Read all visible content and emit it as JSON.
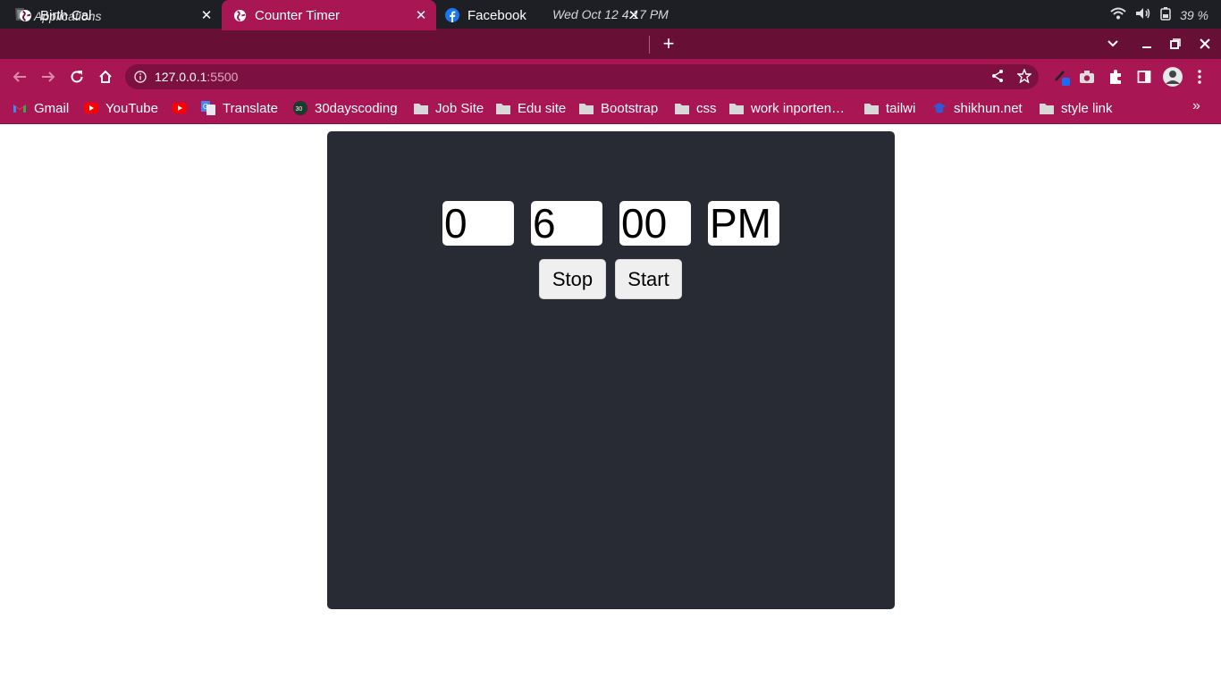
{
  "os": {
    "apps_label": "Applications",
    "clock": "Wed Oct 12   4:17 PM",
    "battery": "39 %"
  },
  "tabs": [
    {
      "title": "Birth Cal",
      "icon": "globe-icon",
      "active": false
    },
    {
      "title": "Counter Timer",
      "icon": "globe-icon",
      "active": true
    },
    {
      "title": "Facebook",
      "icon": "facebook-icon",
      "active": false
    }
  ],
  "address_bar": {
    "host": "127.0.0.1",
    "port": ":5500"
  },
  "bookmarks": [
    {
      "label": "Gmail",
      "icon": "gmail-icon"
    },
    {
      "label": "YouTube",
      "icon": "youtube-icon"
    },
    {
      "label": "",
      "icon": "youtube-icon"
    },
    {
      "label": "Translate",
      "icon": "translate-icon"
    },
    {
      "label": "30dayscoding",
      "icon": "30dayscoding-icon"
    },
    {
      "label": "Job Site",
      "icon": "folder-icon"
    },
    {
      "label": "Edu site",
      "icon": "folder-icon"
    },
    {
      "label": "Bootstrap",
      "icon": "folder-icon"
    },
    {
      "label": "css",
      "icon": "folder-icon"
    },
    {
      "label": "work inporten…",
      "icon": "folder-icon"
    },
    {
      "label": "tailwi",
      "icon": "folder-icon"
    },
    {
      "label": "shikhun.net",
      "icon": "shikhun-icon"
    },
    {
      "label": "style link",
      "icon": "folder-icon"
    }
  ],
  "timer": {
    "fields": [
      "0",
      "6",
      "00",
      "PM"
    ],
    "stop_label": "Stop",
    "start_label": "Start"
  },
  "colors": {
    "tab_strip": "#680f36",
    "toolbar": "#a81654",
    "panel": "#282a34"
  }
}
